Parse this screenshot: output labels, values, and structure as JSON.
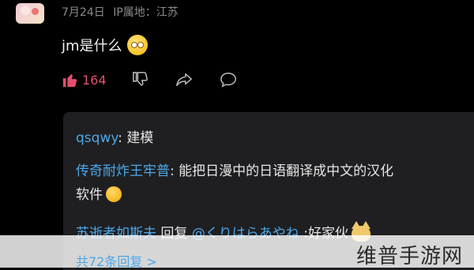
{
  "post_meta": {
    "date": "7月24日",
    "ip_label": "IP属地：江苏"
  },
  "question": {
    "text": "jm是什么"
  },
  "actions": {
    "like_count": "164"
  },
  "replies": [
    {
      "user": "qsqwy",
      "text": "建模"
    },
    {
      "user": "传奇耐炸王牢普",
      "text": "能把日漫中的日语翻译成中文的汉化",
      "text_line2": "软件"
    },
    {
      "user": "苏逝者如斯夫",
      "reply_word": "回复",
      "target": "@くりはらあやね",
      "text": ":好家伙"
    }
  ],
  "see_more": "共72条回复 >",
  "watermark": "维普手游网"
}
